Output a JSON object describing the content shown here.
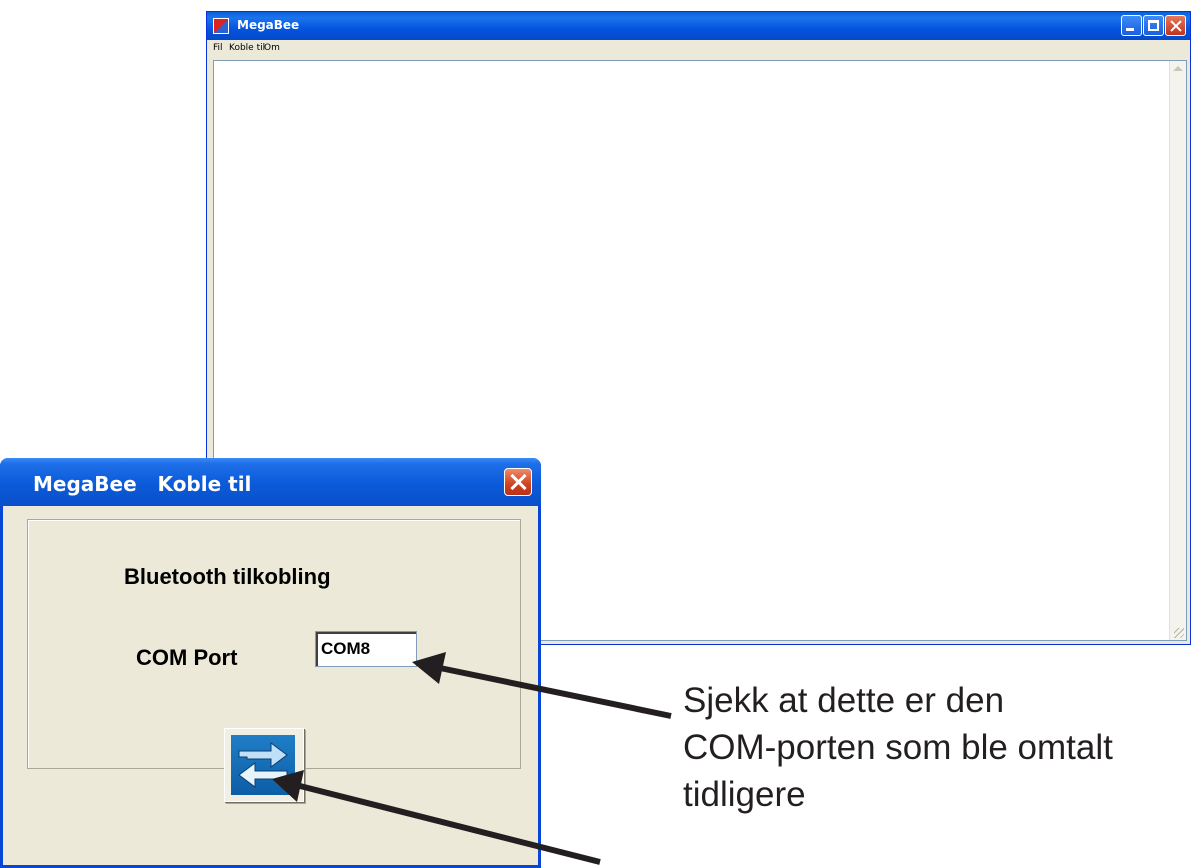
{
  "main_window": {
    "title": "MegaBee",
    "menu": [
      "Fil",
      "Koble til",
      "Om"
    ]
  },
  "dialog": {
    "title": "MegaBee   Koble til",
    "heading": "Bluetooth tilkobling",
    "com_label": "COM Port",
    "com_value": "COM8",
    "connect_button_icon": "connect-arrows-icon"
  },
  "annotation": {
    "lines": [
      "Sjekk at dette er den",
      "COM-porten som ble omtalt",
      "tidligere"
    ]
  },
  "colors": {
    "titlebar_blue": "#0a5fdc",
    "dialog_bg": "#ece9d8",
    "close_red": "#d0411f",
    "annotation_text": "#231f20"
  }
}
